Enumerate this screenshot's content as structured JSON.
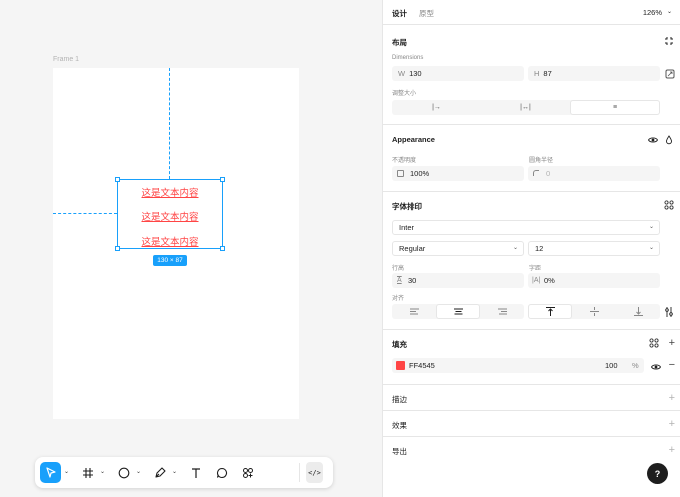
{
  "canvas": {
    "frame_label": "Frame 1",
    "text_lines": [
      "这是文本内容",
      "这是文本内容",
      "这是文本内容"
    ],
    "size_badge": "130 × 87"
  },
  "toolbar": {
    "tools": [
      "move-tool",
      "frame-tool",
      "shape-tool",
      "pen-tool",
      "text-tool",
      "comment-tool",
      "components-tool"
    ],
    "code_label": "</>"
  },
  "panel": {
    "tab_design": "设计",
    "tab_prototype": "原型",
    "zoom": "126%",
    "layout": {
      "title": "布局",
      "dimensions_label": "Dimensions",
      "w_prefix": "W",
      "w_value": "130",
      "h_prefix": "H",
      "h_value": "87",
      "resize_label": "调整大小",
      "resize_options": [
        "|→",
        "|↔|",
        "≡"
      ]
    },
    "appearance": {
      "title": "Appearance",
      "opacity_label": "不透明度",
      "opacity_value": "100%",
      "radius_label": "圆角半径",
      "radius_value": "0"
    },
    "typography": {
      "title": "字体排印",
      "font_family": "Inter",
      "font_style": "Regular",
      "font_size": "12",
      "line_height_label": "行高",
      "line_height_value": "30",
      "letter_spacing_label": "字距",
      "letter_spacing_value": "0%",
      "align_label": "对齐"
    },
    "fill": {
      "title": "填充",
      "hex": "FF4545",
      "opacity": "100",
      "percent": "%",
      "color": "#ff4545"
    },
    "stroke": {
      "title": "描边"
    },
    "effects": {
      "title": "效果"
    },
    "export": {
      "title": "导出"
    },
    "help": "?"
  },
  "colors": {
    "accent": "#18a0fb",
    "text_red": "#ff4545"
  }
}
